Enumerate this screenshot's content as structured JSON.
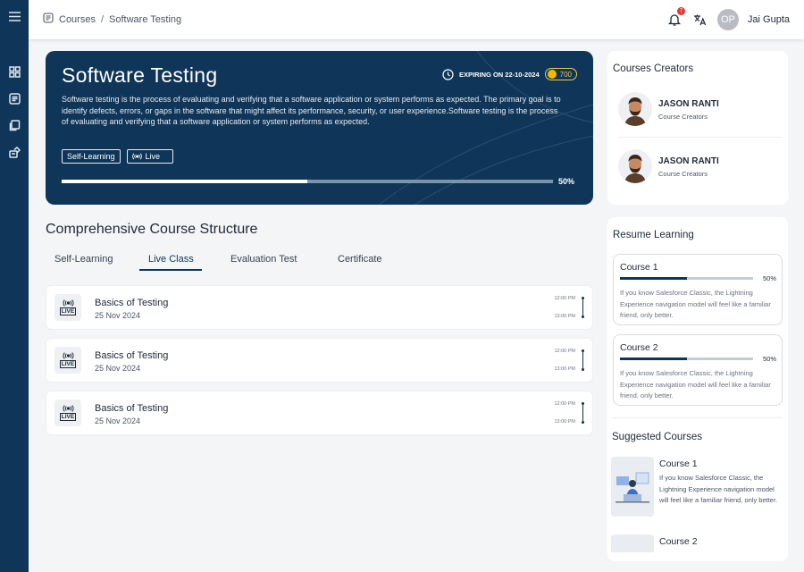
{
  "breadcrumb": {
    "root": "Courses",
    "separator": "/",
    "current": "Software Testing"
  },
  "header": {
    "notification_count": "7",
    "avatar_initials": "OP",
    "user_name": "Jai Gupta"
  },
  "hero": {
    "title": "Software Testing",
    "expiry": "EXPIRING ON 22-10-2024",
    "coins": "700",
    "description": "Software testing is the process of evaluating and verifying that a software application or system performs as expected. The primary goal is to identify defects, errors, or gaps in the software that might affect its performance, security, or user experience.Software testing is the process of evaluating and verifying that a software application or system performs as expected.",
    "tags": [
      "Self-Learning",
      "Live"
    ],
    "progress": 0.5,
    "progress_label": "50%"
  },
  "structure": {
    "title": "Comprehensive Course Structure",
    "tabs": [
      "Self-Learning",
      "Live Class",
      "Evaluation Test",
      "Certificate"
    ],
    "active_tab": "Live Class",
    "lessons": [
      {
        "title": "Basics of Testing",
        "date": "25 Nov 2024",
        "start": "12:00 PM",
        "end": "13:00 PM",
        "icon": "live-icon",
        "badge": "LIVE"
      },
      {
        "title": "Basics of Testing",
        "date": "25 Nov 2024",
        "start": "12:00 PM",
        "end": "13:00 PM",
        "icon": "live-icon",
        "badge": "LIVE"
      },
      {
        "title": "Basics of Testing",
        "date": "25 Nov 2024",
        "start": "12:00 PM",
        "end": "13:00 PM",
        "icon": "live-icon",
        "badge": "LIVE"
      }
    ]
  },
  "creators": {
    "title": "Courses Creators",
    "items": [
      {
        "name": "JASON RANTI",
        "role": "Course Creators"
      },
      {
        "name": "JASON RANTI",
        "role": "Course Creators"
      }
    ]
  },
  "resume": {
    "title": "Resume Learning",
    "items": [
      {
        "course": "Course 1",
        "progress": 0.5,
        "progress_label": "50%",
        "description": "If you know Salesforce Classic, the Lightning Experience navigation model will feel like a familiar friend, only better."
      },
      {
        "course": "Course 2",
        "progress": 0.5,
        "progress_label": "50%",
        "description": "If you know Salesforce Classic, the Lightning Experience navigation model will feel like a familiar friend, only better."
      }
    ]
  },
  "suggested": {
    "title": "Suggested Courses",
    "items": [
      {
        "course": "Course 1",
        "description": "If you know Salesforce Classic, the Lightning Experience navigation model will feel like a familiar friend, only better."
      },
      {
        "course": "Course 2",
        "description": ""
      }
    ]
  },
  "nav_icons": [
    "menu-icon",
    "dashboard-icon",
    "courses-icon",
    "library-icon",
    "assignments-icon"
  ],
  "colors": {
    "primary": "#0f3558",
    "coin": "#f5b800",
    "badge": "#e53935",
    "background": "#f4f5f7"
  }
}
